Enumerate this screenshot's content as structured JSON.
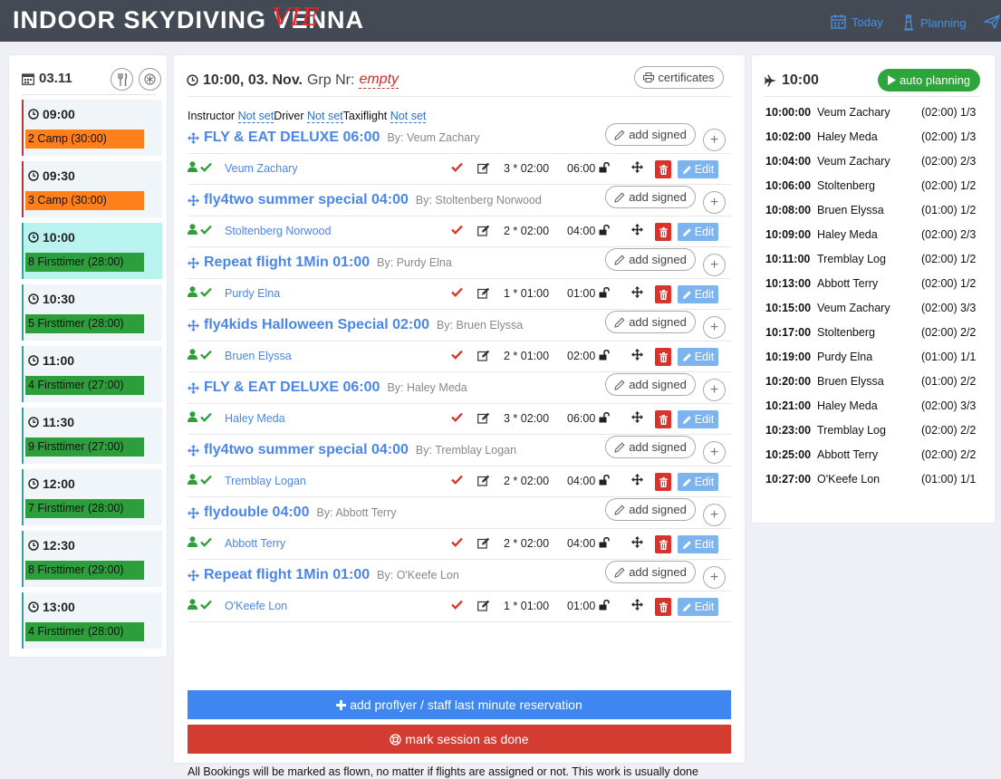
{
  "header": {
    "brand_pre": "INDOOR SKYDIVING ",
    "brand_v_base": "V",
    "brand_v_overlay": "VIE",
    "brand_post": "ENNA",
    "nav_today": "Today",
    "nav_planning": "Planning",
    "accent": "#4a90e2"
  },
  "day": {
    "date": "03.11",
    "slots": [
      {
        "time": "09:00",
        "label": "2 Camp (30:00)",
        "color": "orange"
      },
      {
        "time": "09:30",
        "label": "3 Camp (30:00)",
        "color": "orange"
      },
      {
        "time": "10:00",
        "label": "8 Firsttimer (28:00)",
        "color": "green",
        "active": true
      },
      {
        "time": "10:30",
        "label": "5 Firsttimer (28:00)",
        "color": "green"
      },
      {
        "time": "11:00",
        "label": "4 Firsttimer (27:00)",
        "color": "green"
      },
      {
        "time": "11:30",
        "label": "9 Firsttimer (27:00)",
        "color": "green"
      },
      {
        "time": "12:00",
        "label": "7 Firsttimer (28:00)",
        "color": "green"
      },
      {
        "time": "12:30",
        "label": "8 Firsttimer (29:00)",
        "color": "green"
      },
      {
        "time": "13:00",
        "label": "4 Firsttimer (28:00)",
        "color": "green"
      }
    ]
  },
  "session": {
    "title": "10:00, 03. Nov.",
    "grp_label": "Grp Nr:",
    "grp_value": "empty",
    "certificates_label": "certificates",
    "instructor_label": "Instructor",
    "driver_label": "Driver",
    "taxiflight_label": "Taxiflight",
    "not_set": "Not set",
    "add_signed_label": "add signed",
    "edit_label": "Edit",
    "groups": [
      {
        "title": "FLY & EAT DELUXE 06:00",
        "by": "By: Veum Zachary",
        "flyer": "Veum Zachary",
        "count": "3 * 02:00",
        "duration": "06:00"
      },
      {
        "title": "fly4two summer special 04:00",
        "by": "By: Stoltenberg Norwood",
        "flyer": "Stoltenberg Norwood",
        "count": "2 * 02:00",
        "duration": "04:00"
      },
      {
        "title": "Repeat flight 1Min 01:00",
        "by": "By: Purdy Elna",
        "flyer": "Purdy Elna",
        "count": "1 * 01:00",
        "duration": "01:00"
      },
      {
        "title": "fly4kids Halloween Special 02:00",
        "by": "By: Bruen Elyssa",
        "flyer": "Bruen Elyssa",
        "count": "2 * 01:00",
        "duration": "02:00"
      },
      {
        "title": "FLY & EAT DELUXE 06:00",
        "by": "By: Haley Meda",
        "flyer": "Haley Meda",
        "count": "3 * 02:00",
        "duration": "06:00"
      },
      {
        "title": "fly4two summer special 04:00",
        "by": "By: Tremblay Logan",
        "flyer": "Tremblay Logan",
        "count": "2 * 02:00",
        "duration": "04:00"
      },
      {
        "title": "flydouble 04:00",
        "by": "By: Abbott Terry",
        "flyer": "Abbott Terry",
        "count": "2 * 02:00",
        "duration": "04:00"
      },
      {
        "title": "Repeat flight 1Min 01:00",
        "by": "By: O'Keefe Lon",
        "flyer": "O'Keefe Lon",
        "count": "1 * 01:00",
        "duration": "01:00"
      }
    ],
    "add_proflyer_label": "add proflyer / staff last minute reservation",
    "mark_done_label": "mark session as done",
    "note": "All Bookings will be marked as flown, no matter if flights are assigned or not. This work is usually done automatically by the flasher connection"
  },
  "planning": {
    "title": "10:00",
    "auto_label": "auto planning",
    "rows": [
      {
        "time": "10:00:00",
        "name": "Veum Zachary",
        "dur": "(02:00)",
        "frac": "1/3"
      },
      {
        "time": "10:02:00",
        "name": "Haley Meda",
        "dur": "(02:00)",
        "frac": "1/3"
      },
      {
        "time": "10:04:00",
        "name": "Veum Zachary",
        "dur": "(02:00)",
        "frac": "2/3"
      },
      {
        "time": "10:06:00",
        "name": "Stoltenberg",
        "dur": "(02:00)",
        "frac": "1/2"
      },
      {
        "time": "10:08:00",
        "name": "Bruen Elyssa",
        "dur": "(01:00)",
        "frac": "1/2"
      },
      {
        "time": "10:09:00",
        "name": "Haley Meda",
        "dur": "(02:00)",
        "frac": "2/3"
      },
      {
        "time": "10:11:00",
        "name": "Tremblay Log",
        "dur": "(02:00)",
        "frac": "1/2"
      },
      {
        "time": "10:13:00",
        "name": "Abbott Terry",
        "dur": "(02:00)",
        "frac": "1/2"
      },
      {
        "time": "10:15:00",
        "name": "Veum Zachary",
        "dur": "(02:00)",
        "frac": "3/3"
      },
      {
        "time": "10:17:00",
        "name": "Stoltenberg",
        "dur": "(02:00)",
        "frac": "2/2"
      },
      {
        "time": "10:19:00",
        "name": "Purdy Elna",
        "dur": "(01:00)",
        "frac": "1/1"
      },
      {
        "time": "10:20:00",
        "name": "Bruen Elyssa",
        "dur": "(01:00)",
        "frac": "2/2"
      },
      {
        "time": "10:21:00",
        "name": "Haley Meda",
        "dur": "(02:00)",
        "frac": "3/3"
      },
      {
        "time": "10:23:00",
        "name": "Tremblay Log",
        "dur": "(02:00)",
        "frac": "2/2"
      },
      {
        "time": "10:25:00",
        "name": "Abbott Terry",
        "dur": "(02:00)",
        "frac": "2/2"
      },
      {
        "time": "10:27:00",
        "name": "O'Keefe Lon",
        "dur": "(01:00)",
        "frac": "1/1"
      }
    ]
  }
}
